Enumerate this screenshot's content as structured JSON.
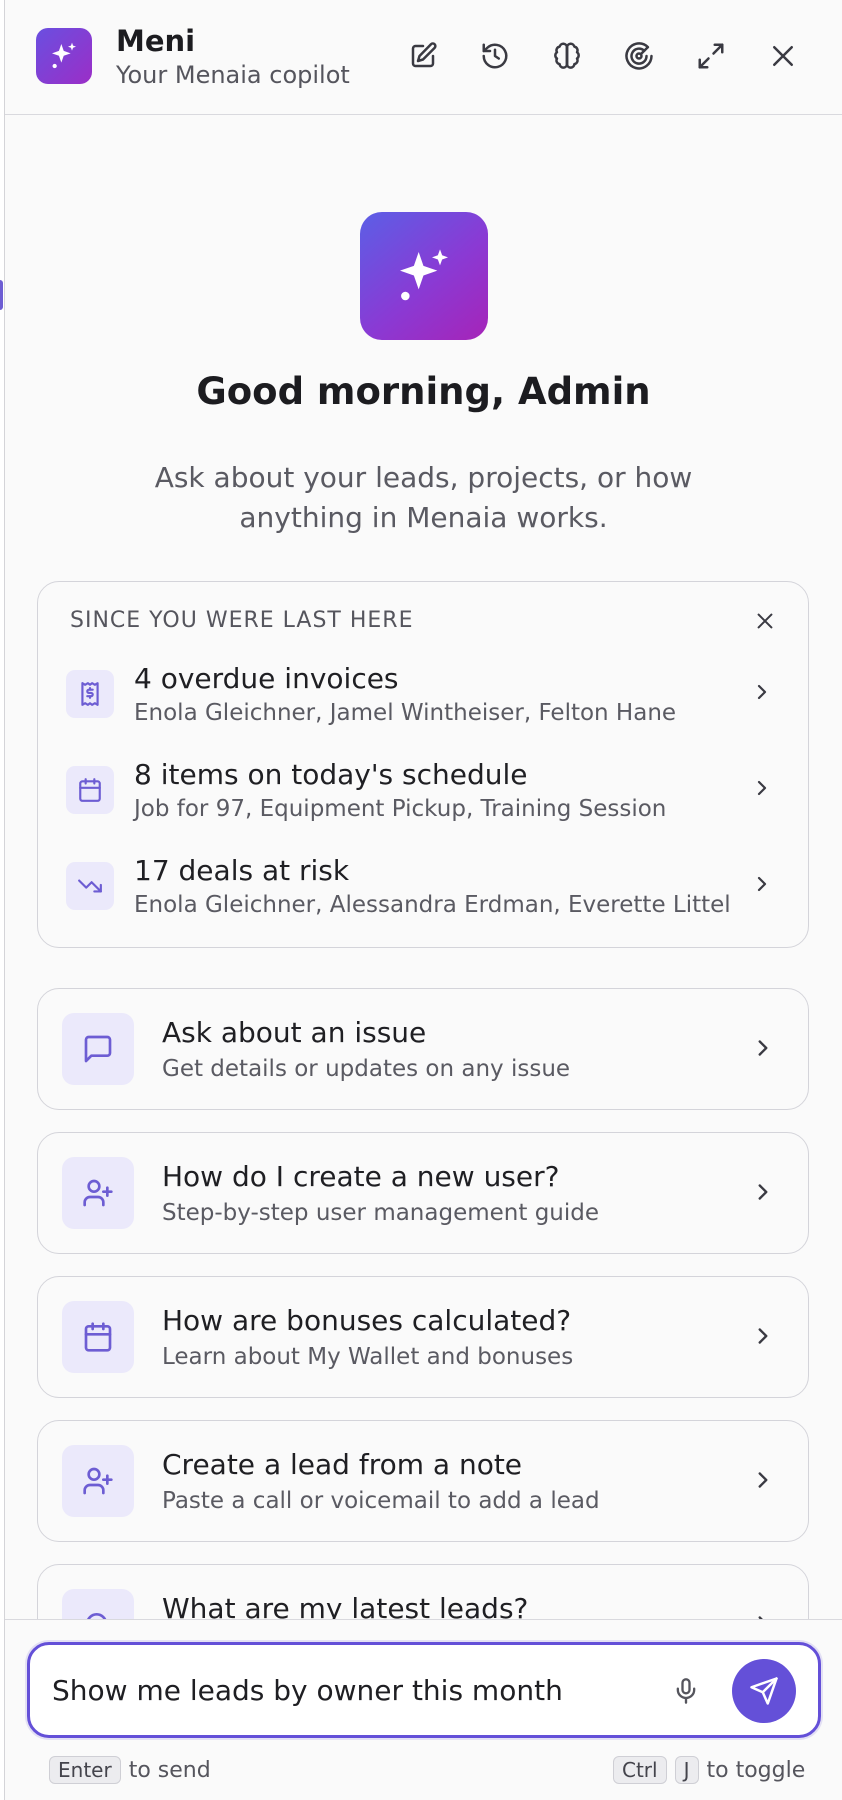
{
  "header": {
    "title": "Meni",
    "subtitle": "Your Menaia copilot",
    "icons": [
      "new-chat-icon",
      "history-icon",
      "brain-icon",
      "radar-icon",
      "expand-icon",
      "close-icon"
    ]
  },
  "hero": {
    "greeting": "Good morning, Admin",
    "intro": "Ask about your leads, projects, or how anything in Menaia works."
  },
  "since": {
    "heading": "SINCE YOU WERE LAST HERE",
    "items": [
      {
        "title": "4 overdue invoices",
        "detail": "Enola Gleichner, Jamel Wintheiser, Felton Hane",
        "icon": "invoice-icon"
      },
      {
        "title": "8 items on today's schedule",
        "detail": "Job for 97, Equipment Pickup, Training Session",
        "icon": "calendar-icon"
      },
      {
        "title": "17 deals at risk",
        "detail": "Enola Gleichner, Alessandra Erdman, Everette Littel",
        "icon": "trending-down-icon"
      }
    ]
  },
  "suggestions": [
    {
      "title": "Ask about an issue",
      "detail": "Get details or updates on any issue",
      "icon": "message-icon"
    },
    {
      "title": "How do I create a new user?",
      "detail": "Step-by-step user management guide",
      "icon": "user-plus-icon"
    },
    {
      "title": "How are bonuses calculated?",
      "detail": "Learn about My Wallet and bonuses",
      "icon": "calendar-icon"
    },
    {
      "title": "Create a lead from a note",
      "detail": "Paste a call or voicemail to add a lead",
      "icon": "user-plus-icon"
    },
    {
      "title": "What are my latest leads?",
      "detail": "",
      "icon": "search-icon"
    }
  ],
  "composer": {
    "value": "Show me leads by owner this month",
    "send_hint_key": "Enter",
    "send_hint_text": "to send",
    "toggle_key_1": "Ctrl",
    "toggle_key_2": "J",
    "toggle_hint_text": "to toggle"
  },
  "colors": {
    "accent": "#6450d8",
    "icon_bg": "#ebe9fb",
    "gradient_start": "#5b5fe6",
    "gradient_end": "#a624b8"
  }
}
